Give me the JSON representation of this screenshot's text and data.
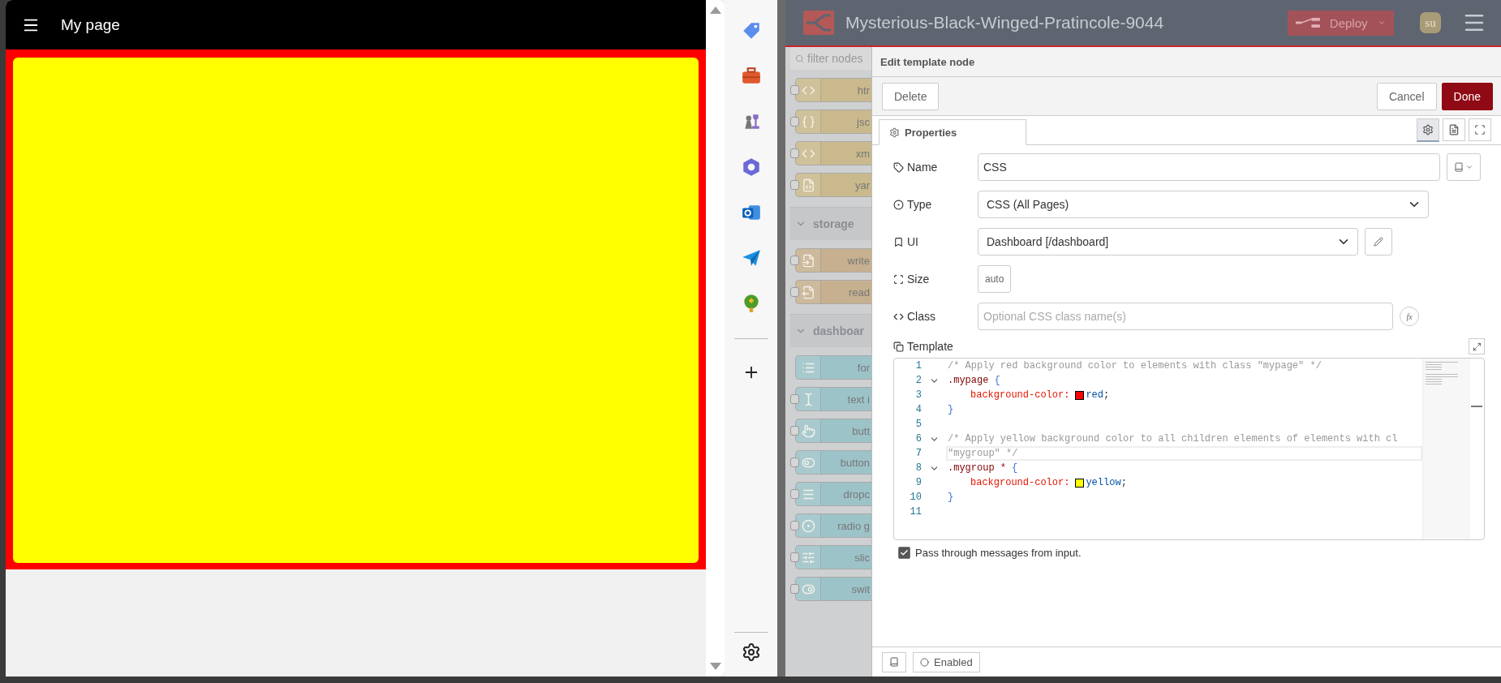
{
  "dashboard": {
    "title": "My page"
  },
  "editor": {
    "title": "Mysterious-Black-Winged-Pratincole-9044",
    "deploy": "Deploy",
    "user": "su"
  },
  "palette": {
    "search_placeholder": "filter nodes",
    "groups": [
      {
        "color": "#c9b98c",
        "items": [
          {
            "kind": "html",
            "label": "htr",
            "input": true
          },
          {
            "kind": "json",
            "label": "jsc",
            "input": true
          },
          {
            "kind": "xml",
            "label": "xm",
            "input": true
          },
          {
            "kind": "yaml",
            "label": "yar",
            "input": true
          }
        ]
      },
      {
        "label": "storage",
        "expanded": true,
        "color": "#c7b08f",
        "items": [
          {
            "kind": "write",
            "label": "write",
            "input": true
          },
          {
            "kind": "read",
            "label": "read",
            "input": true
          }
        ]
      },
      {
        "label": "dashboar",
        "expanded": true,
        "color": "#9cc3c8",
        "items": [
          {
            "kind": "form",
            "label": "for",
            "input": false
          },
          {
            "kind": "text-input",
            "label": "text i",
            "input": true
          },
          {
            "kind": "button",
            "label": "butt",
            "input": true
          },
          {
            "kind": "button-group",
            "label": "button",
            "input": true
          },
          {
            "kind": "dropdown",
            "label": "dropc",
            "input": true
          },
          {
            "kind": "radio",
            "label": "radio g",
            "input": true
          },
          {
            "kind": "slider",
            "label": "slic",
            "input": true
          },
          {
            "kind": "switch",
            "label": "swit",
            "input": true
          }
        ]
      }
    ]
  },
  "tray": {
    "title": "Edit template node",
    "buttons": {
      "delete": "Delete",
      "cancel": "Cancel",
      "done": "Done"
    },
    "tabs": [
      {
        "label": "Properties",
        "selected": true
      }
    ],
    "icon_tabs": [
      {
        "kind": "settings",
        "selected": true
      },
      {
        "kind": "description",
        "selected": false
      },
      {
        "kind": "appearance",
        "selected": false
      }
    ],
    "fields": [
      {
        "kind": "text",
        "label": "Name",
        "value": "CSS"
      },
      {
        "kind": "select",
        "label": "Type",
        "value": "CSS (All Pages)"
      },
      {
        "kind": "select-edit",
        "label": "UI",
        "value": "Dashboard [/dashboard]"
      },
      {
        "kind": "size",
        "label": "Size",
        "value": "auto"
      },
      {
        "kind": "class",
        "label": "Class",
        "placeholder": "Optional CSS class name(s)",
        "button": "fx"
      }
    ],
    "template": {
      "label": "Template",
      "lines": [
        {
          "number": "1",
          "fold": false,
          "active": false,
          "tokens": [
            {
              "kind": "comment",
              "text": "/* Apply red background color to elements with class \"mypage\" */"
            }
          ]
        },
        {
          "number": "2",
          "fold": true,
          "active": false,
          "tokens": [
            {
              "kind": "selector",
              "text": ".mypage"
            },
            {
              "kind": "brace",
              "text": "{"
            }
          ]
        },
        {
          "number": "3",
          "fold": false,
          "active": false,
          "tokens": [
            {
              "kind": "property",
              "text": "background-color:"
            },
            {
              "kind": "swatch",
              "color": "#ff0000"
            },
            {
              "kind": "value",
              "text": "red"
            },
            {
              "kind": "punct",
              "text": ";"
            }
          ]
        },
        {
          "number": "4",
          "fold": false,
          "active": false,
          "tokens": [
            {
              "kind": "brace",
              "text": "}"
            }
          ]
        },
        {
          "number": "5",
          "fold": false,
          "active": false
        },
        {
          "number": "6",
          "fold": true,
          "active": false,
          "tokens": [
            {
              "kind": "comment",
              "text": "/* Apply yellow background color to all children elements of elements with cl"
            }
          ]
        },
        {
          "number": "7",
          "fold": false,
          "active": true,
          "tokens": [
            {
              "kind": "comment",
              "text": "\"mygroup\" */"
            }
          ]
        },
        {
          "number": "8",
          "fold": true,
          "active": false,
          "tokens": [
            {
              "kind": "selector",
              "text": ".mygroup *"
            },
            {
              "kind": "brace",
              "text": "{"
            }
          ]
        },
        {
          "number": "9",
          "fold": false,
          "active": false,
          "tokens": [
            {
              "kind": "property",
              "text": "background-color:"
            },
            {
              "kind": "swatch",
              "color": "#ffff00"
            },
            {
              "kind": "value",
              "text": "yellow"
            },
            {
              "kind": "punct",
              "text": ";"
            }
          ]
        },
        {
          "number": "10",
          "fold": false,
          "active": false,
          "tokens": [
            {
              "kind": "brace",
              "text": "}"
            }
          ]
        },
        {
          "number": "11",
          "fold": false,
          "active": false
        }
      ]
    },
    "passthru": {
      "label": "Pass through messages from input.",
      "checked": true
    },
    "footer": {
      "enabled": "Enabled"
    }
  }
}
